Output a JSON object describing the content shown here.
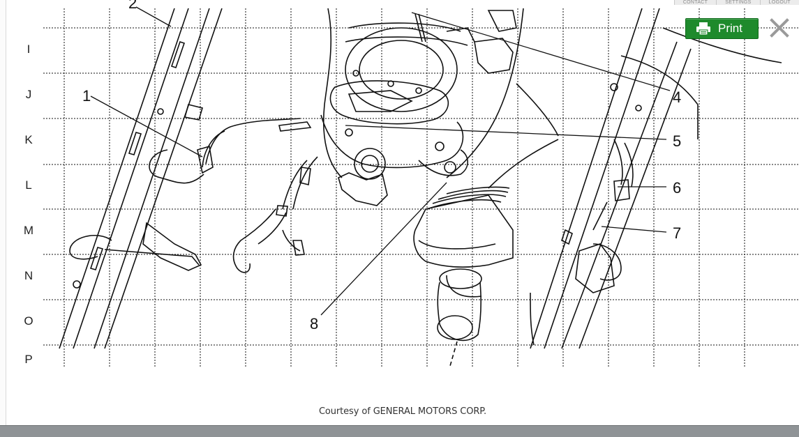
{
  "topnav": {
    "items": [
      "CONTACT",
      "SETTINGS",
      "LOGOUT"
    ]
  },
  "toolbar": {
    "print_label": "Print",
    "print_icon": "printer-icon",
    "close_icon": "close-icon",
    "accent": "#1e8a2c"
  },
  "diagram": {
    "row_labels": [
      "I",
      "J",
      "K",
      "L",
      "M",
      "N",
      "O",
      "P"
    ],
    "callouts": [
      "1",
      "2",
      "4",
      "5",
      "6",
      "7",
      "8"
    ],
    "credit": "Courtesy of GENERAL MOTORS CORP."
  }
}
